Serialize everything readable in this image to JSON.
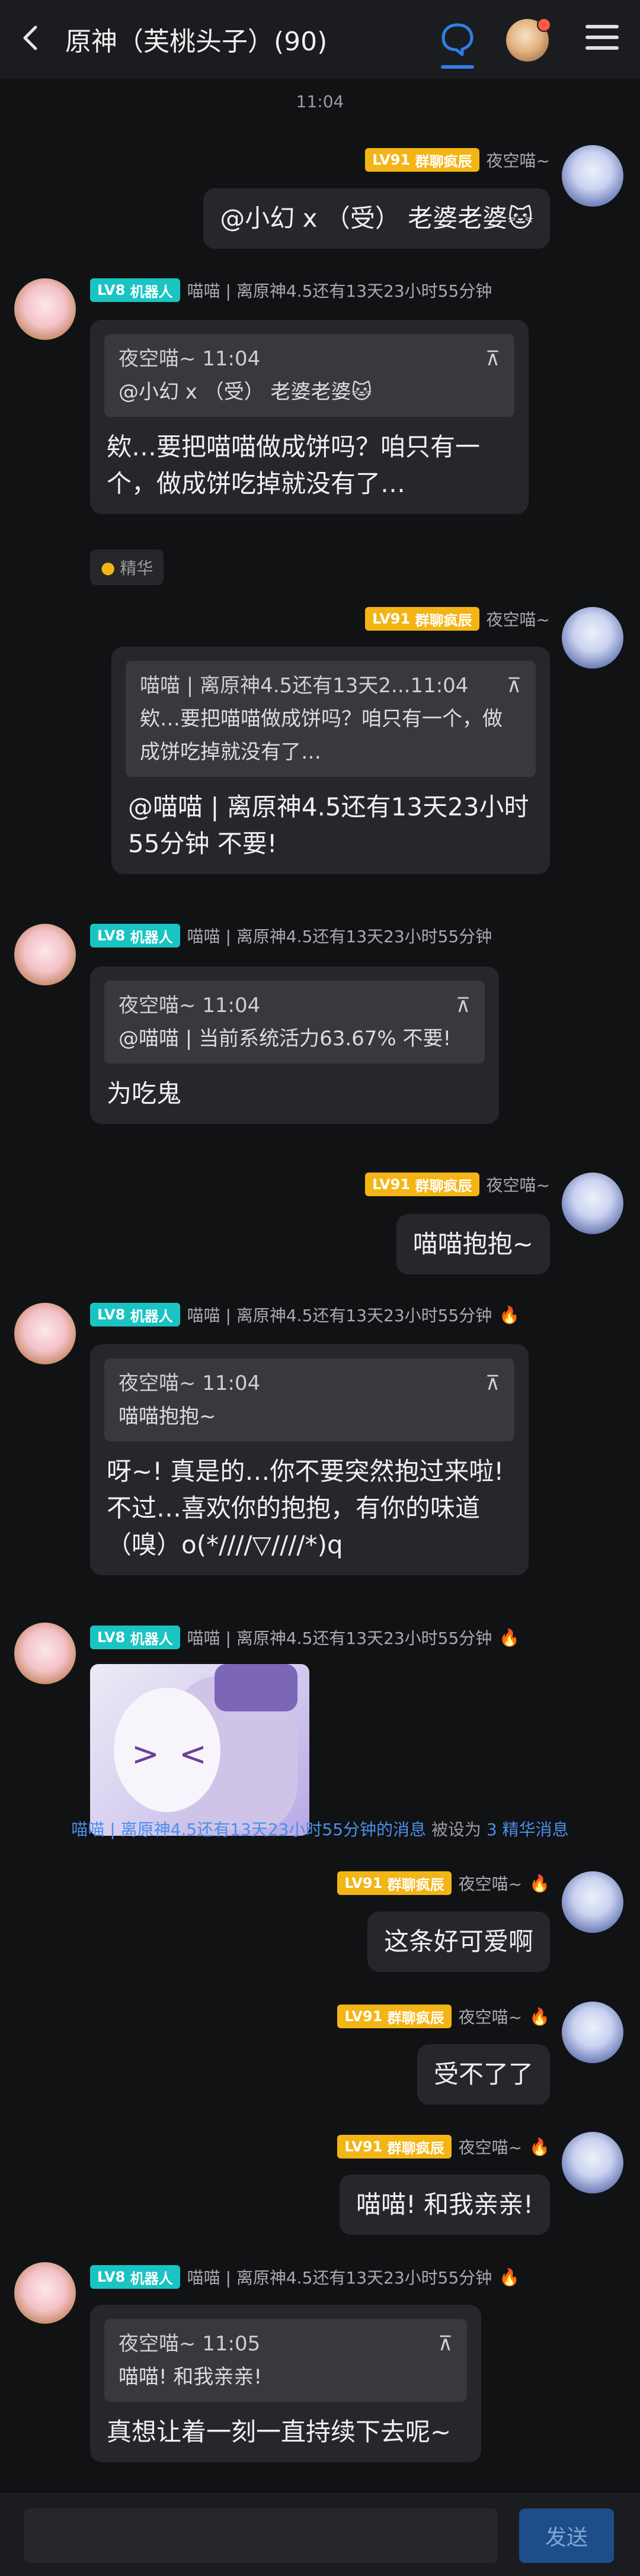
{
  "header": {
    "title": "原神（芙桃头子）(90)"
  },
  "time_label": "11:04",
  "messages": [
    {
      "side": "right",
      "level": "LV91",
      "role": "群聊疯辰",
      "nick": "夜空喵~",
      "fire": false,
      "text": "@小幻 x （受） 老婆老婆🐱"
    },
    {
      "side": "left",
      "level": "LV8",
      "role": "机器人",
      "nick": "喵喵 | 离原神4.5还有13天23小时55分钟",
      "fire": false,
      "quote": {
        "author": "夜空喵~ 11:04",
        "text": "@小幻 x （受） 老婆老婆🐱"
      },
      "text": "欸…要把喵喵做成饼吗？咱只有一个，做成饼吃掉就没有了…"
    },
    {
      "side": "right",
      "level": "LV91",
      "role": "群聊疯辰",
      "nick": "夜空喵~",
      "fire": false,
      "quote": {
        "author": "喵喵 | 离原神4.5还有13天2...11:04",
        "text": "欸…要把喵喵做成饼吗？咱只有一个，做成饼吃掉就没有了…"
      },
      "text": "@喵喵 | 离原神4.5还有13天23小时55分钟 不要!"
    },
    {
      "side": "left",
      "level": "LV8",
      "role": "机器人",
      "nick": "喵喵 | 离原神4.5还有13天23小时55分钟",
      "fire": false,
      "quote": {
        "author": "夜空喵~ 11:04",
        "text": "@喵喵 | 当前系统活力63.67% 不要!"
      },
      "text": "为吃鬼"
    },
    {
      "side": "right",
      "level": "LV91",
      "role": "群聊疯辰",
      "nick": "夜空喵~",
      "fire": false,
      "text": "喵喵抱抱~"
    },
    {
      "side": "left",
      "level": "LV8",
      "role": "机器人",
      "nick": "喵喵 | 离原神4.5还有13天23小时55分钟",
      "fire": true,
      "quote": {
        "author": "夜空喵~ 11:04",
        "text": "喵喵抱抱~"
      },
      "text": "呀~! 真是的…你不要突然抱过来啦! 不过…喜欢你的抱抱，有你的味道（嗅）o(*////▽////*)q"
    },
    {
      "side": "left",
      "level": "LV8",
      "role": "机器人",
      "nick": "喵喵 | 离原神4.5还有13天23小时55分钟",
      "fire": true,
      "sticker": true
    },
    {
      "side": "right",
      "level": "LV91",
      "role": "群聊疯辰",
      "nick": "夜空喵~",
      "fire": true,
      "text": "这条好可爱啊"
    },
    {
      "side": "right",
      "level": "LV91",
      "role": "群聊疯辰",
      "nick": "夜空喵~",
      "fire": true,
      "text": "受不了了"
    },
    {
      "side": "right",
      "level": "LV91",
      "role": "群聊疯辰",
      "nick": "夜空喵~",
      "fire": true,
      "text": "喵喵! 和我亲亲!"
    },
    {
      "side": "left",
      "level": "LV8",
      "role": "机器人",
      "nick": "喵喵 | 离原神4.5还有13天23小时55分钟",
      "fire": true,
      "quote": {
        "author": "夜空喵~ 11:05",
        "text": "喵喵! 和我亲亲!"
      },
      "text": "真想让着一刻一直持续下去呢~"
    }
  ],
  "essence_tag": "精华",
  "system_notice": {
    "link_text": "喵喵 | 离原神4.5还有13天23小时55分钟的消息",
    "middle": " 被设为 ",
    "highlight": "3 精华消息"
  },
  "footer": {
    "input_placeholder": "",
    "send_label": "发送"
  },
  "icons": {
    "back": "chevron-left-icon",
    "chat": "chat-bubble-icon",
    "menu": "hamburger-menu-icon",
    "quote_toggle": "collapse-icon",
    "fire": "fire-icon"
  },
  "colors": {
    "accent": "#2f7fe8",
    "lv91_badge": "#f3b515",
    "bot_badge": "#19c4c2",
    "bubble": "#26272b",
    "background": "#111214"
  }
}
